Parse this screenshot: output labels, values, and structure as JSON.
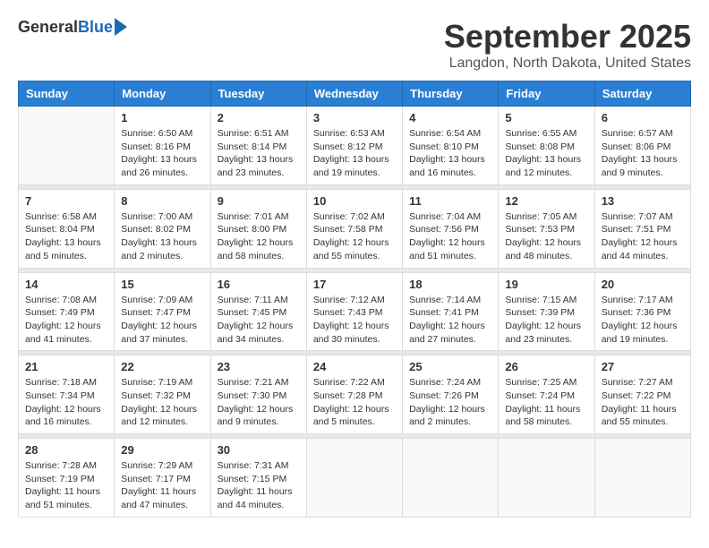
{
  "header": {
    "logo_general": "General",
    "logo_blue": "Blue",
    "month_title": "September 2025",
    "location": "Langdon, North Dakota, United States"
  },
  "weekdays": [
    "Sunday",
    "Monday",
    "Tuesday",
    "Wednesday",
    "Thursday",
    "Friday",
    "Saturday"
  ],
  "weeks": [
    [
      {
        "day": "",
        "info": ""
      },
      {
        "day": "1",
        "info": "Sunrise: 6:50 AM\nSunset: 8:16 PM\nDaylight: 13 hours\nand 26 minutes."
      },
      {
        "day": "2",
        "info": "Sunrise: 6:51 AM\nSunset: 8:14 PM\nDaylight: 13 hours\nand 23 minutes."
      },
      {
        "day": "3",
        "info": "Sunrise: 6:53 AM\nSunset: 8:12 PM\nDaylight: 13 hours\nand 19 minutes."
      },
      {
        "day": "4",
        "info": "Sunrise: 6:54 AM\nSunset: 8:10 PM\nDaylight: 13 hours\nand 16 minutes."
      },
      {
        "day": "5",
        "info": "Sunrise: 6:55 AM\nSunset: 8:08 PM\nDaylight: 13 hours\nand 12 minutes."
      },
      {
        "day": "6",
        "info": "Sunrise: 6:57 AM\nSunset: 8:06 PM\nDaylight: 13 hours\nand 9 minutes."
      }
    ],
    [
      {
        "day": "7",
        "info": "Sunrise: 6:58 AM\nSunset: 8:04 PM\nDaylight: 13 hours\nand 5 minutes."
      },
      {
        "day": "8",
        "info": "Sunrise: 7:00 AM\nSunset: 8:02 PM\nDaylight: 13 hours\nand 2 minutes."
      },
      {
        "day": "9",
        "info": "Sunrise: 7:01 AM\nSunset: 8:00 PM\nDaylight: 12 hours\nand 58 minutes."
      },
      {
        "day": "10",
        "info": "Sunrise: 7:02 AM\nSunset: 7:58 PM\nDaylight: 12 hours\nand 55 minutes."
      },
      {
        "day": "11",
        "info": "Sunrise: 7:04 AM\nSunset: 7:56 PM\nDaylight: 12 hours\nand 51 minutes."
      },
      {
        "day": "12",
        "info": "Sunrise: 7:05 AM\nSunset: 7:53 PM\nDaylight: 12 hours\nand 48 minutes."
      },
      {
        "day": "13",
        "info": "Sunrise: 7:07 AM\nSunset: 7:51 PM\nDaylight: 12 hours\nand 44 minutes."
      }
    ],
    [
      {
        "day": "14",
        "info": "Sunrise: 7:08 AM\nSunset: 7:49 PM\nDaylight: 12 hours\nand 41 minutes."
      },
      {
        "day": "15",
        "info": "Sunrise: 7:09 AM\nSunset: 7:47 PM\nDaylight: 12 hours\nand 37 minutes."
      },
      {
        "day": "16",
        "info": "Sunrise: 7:11 AM\nSunset: 7:45 PM\nDaylight: 12 hours\nand 34 minutes."
      },
      {
        "day": "17",
        "info": "Sunrise: 7:12 AM\nSunset: 7:43 PM\nDaylight: 12 hours\nand 30 minutes."
      },
      {
        "day": "18",
        "info": "Sunrise: 7:14 AM\nSunset: 7:41 PM\nDaylight: 12 hours\nand 27 minutes."
      },
      {
        "day": "19",
        "info": "Sunrise: 7:15 AM\nSunset: 7:39 PM\nDaylight: 12 hours\nand 23 minutes."
      },
      {
        "day": "20",
        "info": "Sunrise: 7:17 AM\nSunset: 7:36 PM\nDaylight: 12 hours\nand 19 minutes."
      }
    ],
    [
      {
        "day": "21",
        "info": "Sunrise: 7:18 AM\nSunset: 7:34 PM\nDaylight: 12 hours\nand 16 minutes."
      },
      {
        "day": "22",
        "info": "Sunrise: 7:19 AM\nSunset: 7:32 PM\nDaylight: 12 hours\nand 12 minutes."
      },
      {
        "day": "23",
        "info": "Sunrise: 7:21 AM\nSunset: 7:30 PM\nDaylight: 12 hours\nand 9 minutes."
      },
      {
        "day": "24",
        "info": "Sunrise: 7:22 AM\nSunset: 7:28 PM\nDaylight: 12 hours\nand 5 minutes."
      },
      {
        "day": "25",
        "info": "Sunrise: 7:24 AM\nSunset: 7:26 PM\nDaylight: 12 hours\nand 2 minutes."
      },
      {
        "day": "26",
        "info": "Sunrise: 7:25 AM\nSunset: 7:24 PM\nDaylight: 11 hours\nand 58 minutes."
      },
      {
        "day": "27",
        "info": "Sunrise: 7:27 AM\nSunset: 7:22 PM\nDaylight: 11 hours\nand 55 minutes."
      }
    ],
    [
      {
        "day": "28",
        "info": "Sunrise: 7:28 AM\nSunset: 7:19 PM\nDaylight: 11 hours\nand 51 minutes."
      },
      {
        "day": "29",
        "info": "Sunrise: 7:29 AM\nSunset: 7:17 PM\nDaylight: 11 hours\nand 47 minutes."
      },
      {
        "day": "30",
        "info": "Sunrise: 7:31 AM\nSunset: 7:15 PM\nDaylight: 11 hours\nand 44 minutes."
      },
      {
        "day": "",
        "info": ""
      },
      {
        "day": "",
        "info": ""
      },
      {
        "day": "",
        "info": ""
      },
      {
        "day": "",
        "info": ""
      }
    ]
  ]
}
